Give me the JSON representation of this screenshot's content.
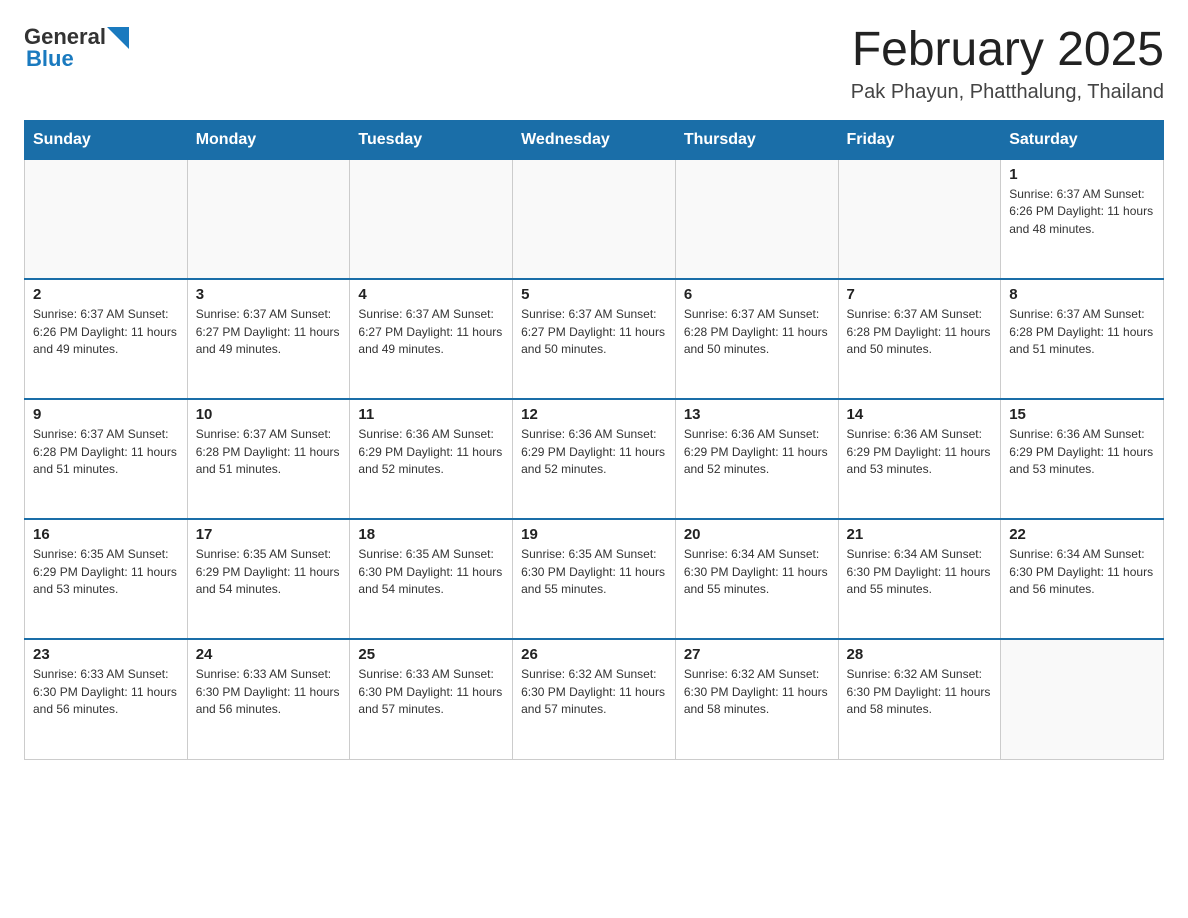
{
  "logo": {
    "general": "General",
    "blue": "Blue"
  },
  "header": {
    "month": "February 2025",
    "location": "Pak Phayun, Phatthalung, Thailand"
  },
  "weekdays": [
    "Sunday",
    "Monday",
    "Tuesday",
    "Wednesday",
    "Thursday",
    "Friday",
    "Saturday"
  ],
  "weeks": [
    [
      {
        "day": "",
        "info": ""
      },
      {
        "day": "",
        "info": ""
      },
      {
        "day": "",
        "info": ""
      },
      {
        "day": "",
        "info": ""
      },
      {
        "day": "",
        "info": ""
      },
      {
        "day": "",
        "info": ""
      },
      {
        "day": "1",
        "info": "Sunrise: 6:37 AM\nSunset: 6:26 PM\nDaylight: 11 hours and 48 minutes."
      }
    ],
    [
      {
        "day": "2",
        "info": "Sunrise: 6:37 AM\nSunset: 6:26 PM\nDaylight: 11 hours and 49 minutes."
      },
      {
        "day": "3",
        "info": "Sunrise: 6:37 AM\nSunset: 6:27 PM\nDaylight: 11 hours and 49 minutes."
      },
      {
        "day": "4",
        "info": "Sunrise: 6:37 AM\nSunset: 6:27 PM\nDaylight: 11 hours and 49 minutes."
      },
      {
        "day": "5",
        "info": "Sunrise: 6:37 AM\nSunset: 6:27 PM\nDaylight: 11 hours and 50 minutes."
      },
      {
        "day": "6",
        "info": "Sunrise: 6:37 AM\nSunset: 6:28 PM\nDaylight: 11 hours and 50 minutes."
      },
      {
        "day": "7",
        "info": "Sunrise: 6:37 AM\nSunset: 6:28 PM\nDaylight: 11 hours and 50 minutes."
      },
      {
        "day": "8",
        "info": "Sunrise: 6:37 AM\nSunset: 6:28 PM\nDaylight: 11 hours and 51 minutes."
      }
    ],
    [
      {
        "day": "9",
        "info": "Sunrise: 6:37 AM\nSunset: 6:28 PM\nDaylight: 11 hours and 51 minutes."
      },
      {
        "day": "10",
        "info": "Sunrise: 6:37 AM\nSunset: 6:28 PM\nDaylight: 11 hours and 51 minutes."
      },
      {
        "day": "11",
        "info": "Sunrise: 6:36 AM\nSunset: 6:29 PM\nDaylight: 11 hours and 52 minutes."
      },
      {
        "day": "12",
        "info": "Sunrise: 6:36 AM\nSunset: 6:29 PM\nDaylight: 11 hours and 52 minutes."
      },
      {
        "day": "13",
        "info": "Sunrise: 6:36 AM\nSunset: 6:29 PM\nDaylight: 11 hours and 52 minutes."
      },
      {
        "day": "14",
        "info": "Sunrise: 6:36 AM\nSunset: 6:29 PM\nDaylight: 11 hours and 53 minutes."
      },
      {
        "day": "15",
        "info": "Sunrise: 6:36 AM\nSunset: 6:29 PM\nDaylight: 11 hours and 53 minutes."
      }
    ],
    [
      {
        "day": "16",
        "info": "Sunrise: 6:35 AM\nSunset: 6:29 PM\nDaylight: 11 hours and 53 minutes."
      },
      {
        "day": "17",
        "info": "Sunrise: 6:35 AM\nSunset: 6:29 PM\nDaylight: 11 hours and 54 minutes."
      },
      {
        "day": "18",
        "info": "Sunrise: 6:35 AM\nSunset: 6:30 PM\nDaylight: 11 hours and 54 minutes."
      },
      {
        "day": "19",
        "info": "Sunrise: 6:35 AM\nSunset: 6:30 PM\nDaylight: 11 hours and 55 minutes."
      },
      {
        "day": "20",
        "info": "Sunrise: 6:34 AM\nSunset: 6:30 PM\nDaylight: 11 hours and 55 minutes."
      },
      {
        "day": "21",
        "info": "Sunrise: 6:34 AM\nSunset: 6:30 PM\nDaylight: 11 hours and 55 minutes."
      },
      {
        "day": "22",
        "info": "Sunrise: 6:34 AM\nSunset: 6:30 PM\nDaylight: 11 hours and 56 minutes."
      }
    ],
    [
      {
        "day": "23",
        "info": "Sunrise: 6:33 AM\nSunset: 6:30 PM\nDaylight: 11 hours and 56 minutes."
      },
      {
        "day": "24",
        "info": "Sunrise: 6:33 AM\nSunset: 6:30 PM\nDaylight: 11 hours and 56 minutes."
      },
      {
        "day": "25",
        "info": "Sunrise: 6:33 AM\nSunset: 6:30 PM\nDaylight: 11 hours and 57 minutes."
      },
      {
        "day": "26",
        "info": "Sunrise: 6:32 AM\nSunset: 6:30 PM\nDaylight: 11 hours and 57 minutes."
      },
      {
        "day": "27",
        "info": "Sunrise: 6:32 AM\nSunset: 6:30 PM\nDaylight: 11 hours and 58 minutes."
      },
      {
        "day": "28",
        "info": "Sunrise: 6:32 AM\nSunset: 6:30 PM\nDaylight: 11 hours and 58 minutes."
      },
      {
        "day": "",
        "info": ""
      }
    ]
  ]
}
